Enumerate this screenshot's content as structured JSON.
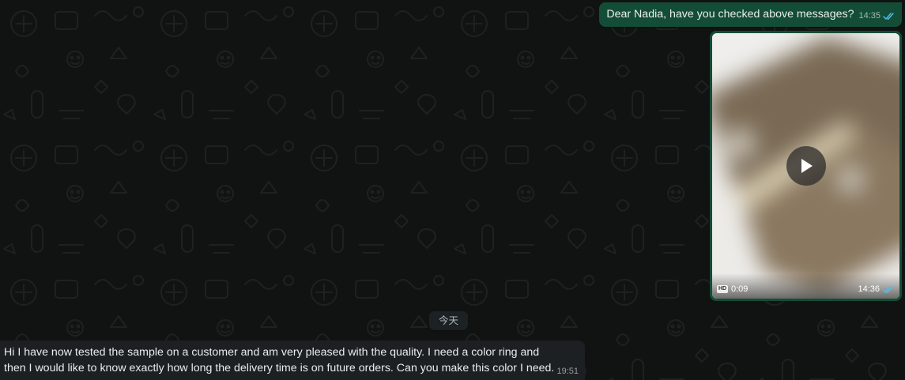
{
  "messages": {
    "outgoing_text": {
      "text": "Dear Nadia, have you checked above messages?",
      "time": "14:35",
      "status": "read"
    },
    "outgoing_video": {
      "duration": "0:09",
      "quality_badge": "HD",
      "time": "14:36",
      "status": "read"
    },
    "date_divider": "今天",
    "incoming_text": {
      "text": "Hi I have now tested the sample on a customer and am very pleased with the quality. I need a color ring and then I would like to know exactly how long the delivery time is on future orders. Can you make this color I need.",
      "time": "19:51"
    }
  },
  "colors": {
    "background": "#111312",
    "outgoing_bubble": "#144d37",
    "incoming_bubble": "#1d2023",
    "read_ticks": "#53bdeb",
    "text": "#e9edef"
  },
  "icons": {
    "read_receipt": "double-check-icon",
    "play": "play-icon",
    "hd": "hd-badge-icon"
  }
}
